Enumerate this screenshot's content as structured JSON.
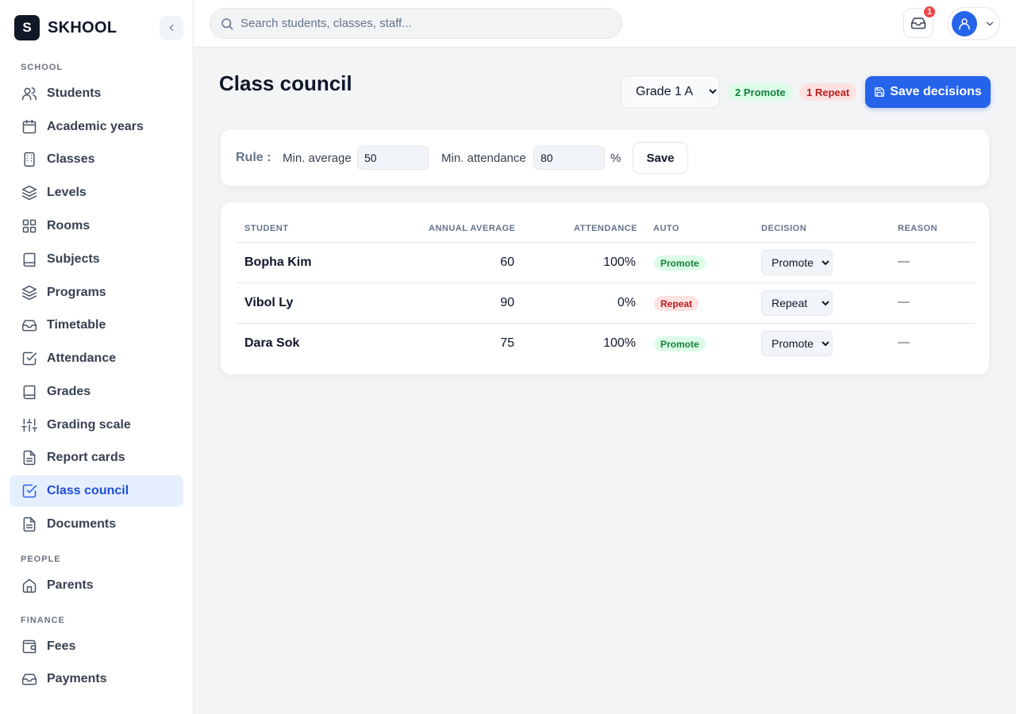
{
  "app": {
    "logo_letter": "S",
    "name": "SKHOOL"
  },
  "sidebar": {
    "sections": {
      "school": "SCHOOL",
      "people": "PEOPLE",
      "finance": "FINANCE"
    },
    "items": [
      {
        "label": "Students",
        "icon": "users-icon"
      },
      {
        "label": "Academic years",
        "icon": "calendar-icon"
      },
      {
        "label": "Classes",
        "icon": "building-icon"
      },
      {
        "label": "Levels",
        "icon": "layers-icon"
      },
      {
        "label": "Rooms",
        "icon": "grid-icon"
      },
      {
        "label": "Subjects",
        "icon": "book-icon"
      },
      {
        "label": "Programs",
        "icon": "layers-icon"
      },
      {
        "label": "Timetable",
        "icon": "inbox-icon"
      },
      {
        "label": "Attendance",
        "icon": "check-square-icon"
      },
      {
        "label": "Grades",
        "icon": "book-icon"
      },
      {
        "label": "Grading scale",
        "icon": "sliders-icon"
      },
      {
        "label": "Report cards",
        "icon": "file-text-icon"
      },
      {
        "label": "Class council",
        "icon": "check-square-icon",
        "active": true
      },
      {
        "label": "Documents",
        "icon": "file-text-icon"
      },
      {
        "label": "Parents",
        "icon": "home-icon"
      },
      {
        "label": "Fees",
        "icon": "wallet-icon"
      },
      {
        "label": "Payments",
        "icon": "inbox-icon"
      }
    ]
  },
  "topbar": {
    "search_placeholder": "Search students, classes, staff...",
    "notification_count": "1"
  },
  "header": {
    "title": "Class council",
    "class_selected": "Grade 1 A",
    "promote_summary": "2 Promote",
    "repeat_summary": "1 Repeat",
    "save_label": "Save decisions"
  },
  "rule": {
    "title": "Rule :",
    "min_average_label": "Min. average",
    "min_average_value": "50",
    "min_attendance_label": "Min. attendance",
    "min_attendance_value": "80",
    "percent": "%",
    "save_label": "Save"
  },
  "table": {
    "headers": [
      "STUDENT",
      "ANNUAL AVERAGE",
      "ATTENDANCE",
      "AUTO",
      "DECISION",
      "REASON"
    ],
    "rows": [
      {
        "student": "Bopha Kim",
        "average": "60",
        "attendance": "100%",
        "auto": "Promote",
        "decision": "Promote",
        "reason": "—"
      },
      {
        "student": "Vibol Ly",
        "average": "90",
        "attendance": "0%",
        "auto": "Repeat",
        "decision": "Repeat",
        "reason": "—"
      },
      {
        "student": "Dara Sok",
        "average": "75",
        "attendance": "100%",
        "auto": "Promote",
        "decision": "Promote",
        "reason": "—"
      }
    ],
    "decision_options": [
      "Promote",
      "Repeat"
    ]
  },
  "colors": {
    "accent": "#2563eb",
    "promote_bg": "#dcfce7",
    "promote_fg": "#15803d",
    "repeat_bg": "#fee2e2",
    "repeat_fg": "#b91c1c"
  }
}
